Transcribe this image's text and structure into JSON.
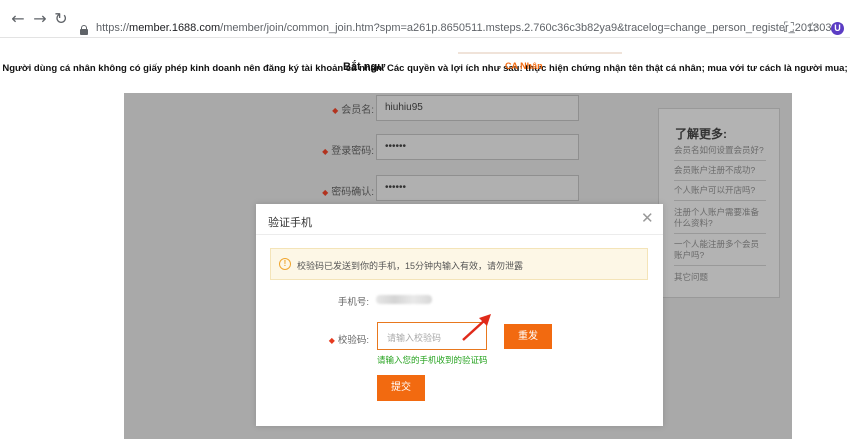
{
  "browser": {
    "url_scheme": "https://",
    "url_domain": "member.1688.com",
    "url_path": "/member/join/common_join.htm?spm=a261p.8650511.msteps.2.760c36c3b82ya9&tracelog=change_person_register_20130322",
    "icons": [
      "back-icon",
      "forward-icon",
      "reload-icon",
      "lock-icon",
      "translate-icon",
      "star-icon",
      "extension-icon"
    ],
    "extension_letter": "U"
  },
  "page": {
    "notice": "Người dùng cá nhân không có giấy phép kinh doanh nên đăng ký tài khoản cá nhân. Các quyền và lợi ích như sau: thực hiện chứng nhận tên thật cá nhân; mua với tư cách là người mua;",
    "overlay_text_1": "Bắt ngư",
    "overlay_text_2": "CA Nhân",
    "overlay_color": "#f26a10"
  },
  "form": {
    "member_name_label": "会员名:",
    "member_name_value": "hiuhiu95",
    "password_label": "登录密码:",
    "password_value": "••••••",
    "confirm_label": "密码确认:",
    "confirm_value": "••••••"
  },
  "sidebar": {
    "title": "了解更多:",
    "links": [
      "会员名如何设置会员好?",
      "会员账户注册不成功?",
      "个人账户可以开店吗?",
      "注册个人账户需要准备什么资料?",
      "一个人能注册多个会员账户吗?",
      "其它问题"
    ]
  },
  "modal": {
    "title": "验证手机",
    "close_symbol": "✕",
    "info_text": "校验码已发送到你的手机，15分钟内输入有效，请勿泄露",
    "phone_label": "手机号:",
    "code_label": "校验码:",
    "code_placeholder": "请输入校验码",
    "resend_label": "重发",
    "hint": "请输入您的手机收到的验证码",
    "submit_label": "提交",
    "accent_color": "#f26a10",
    "hint_color": "#26a31f"
  }
}
